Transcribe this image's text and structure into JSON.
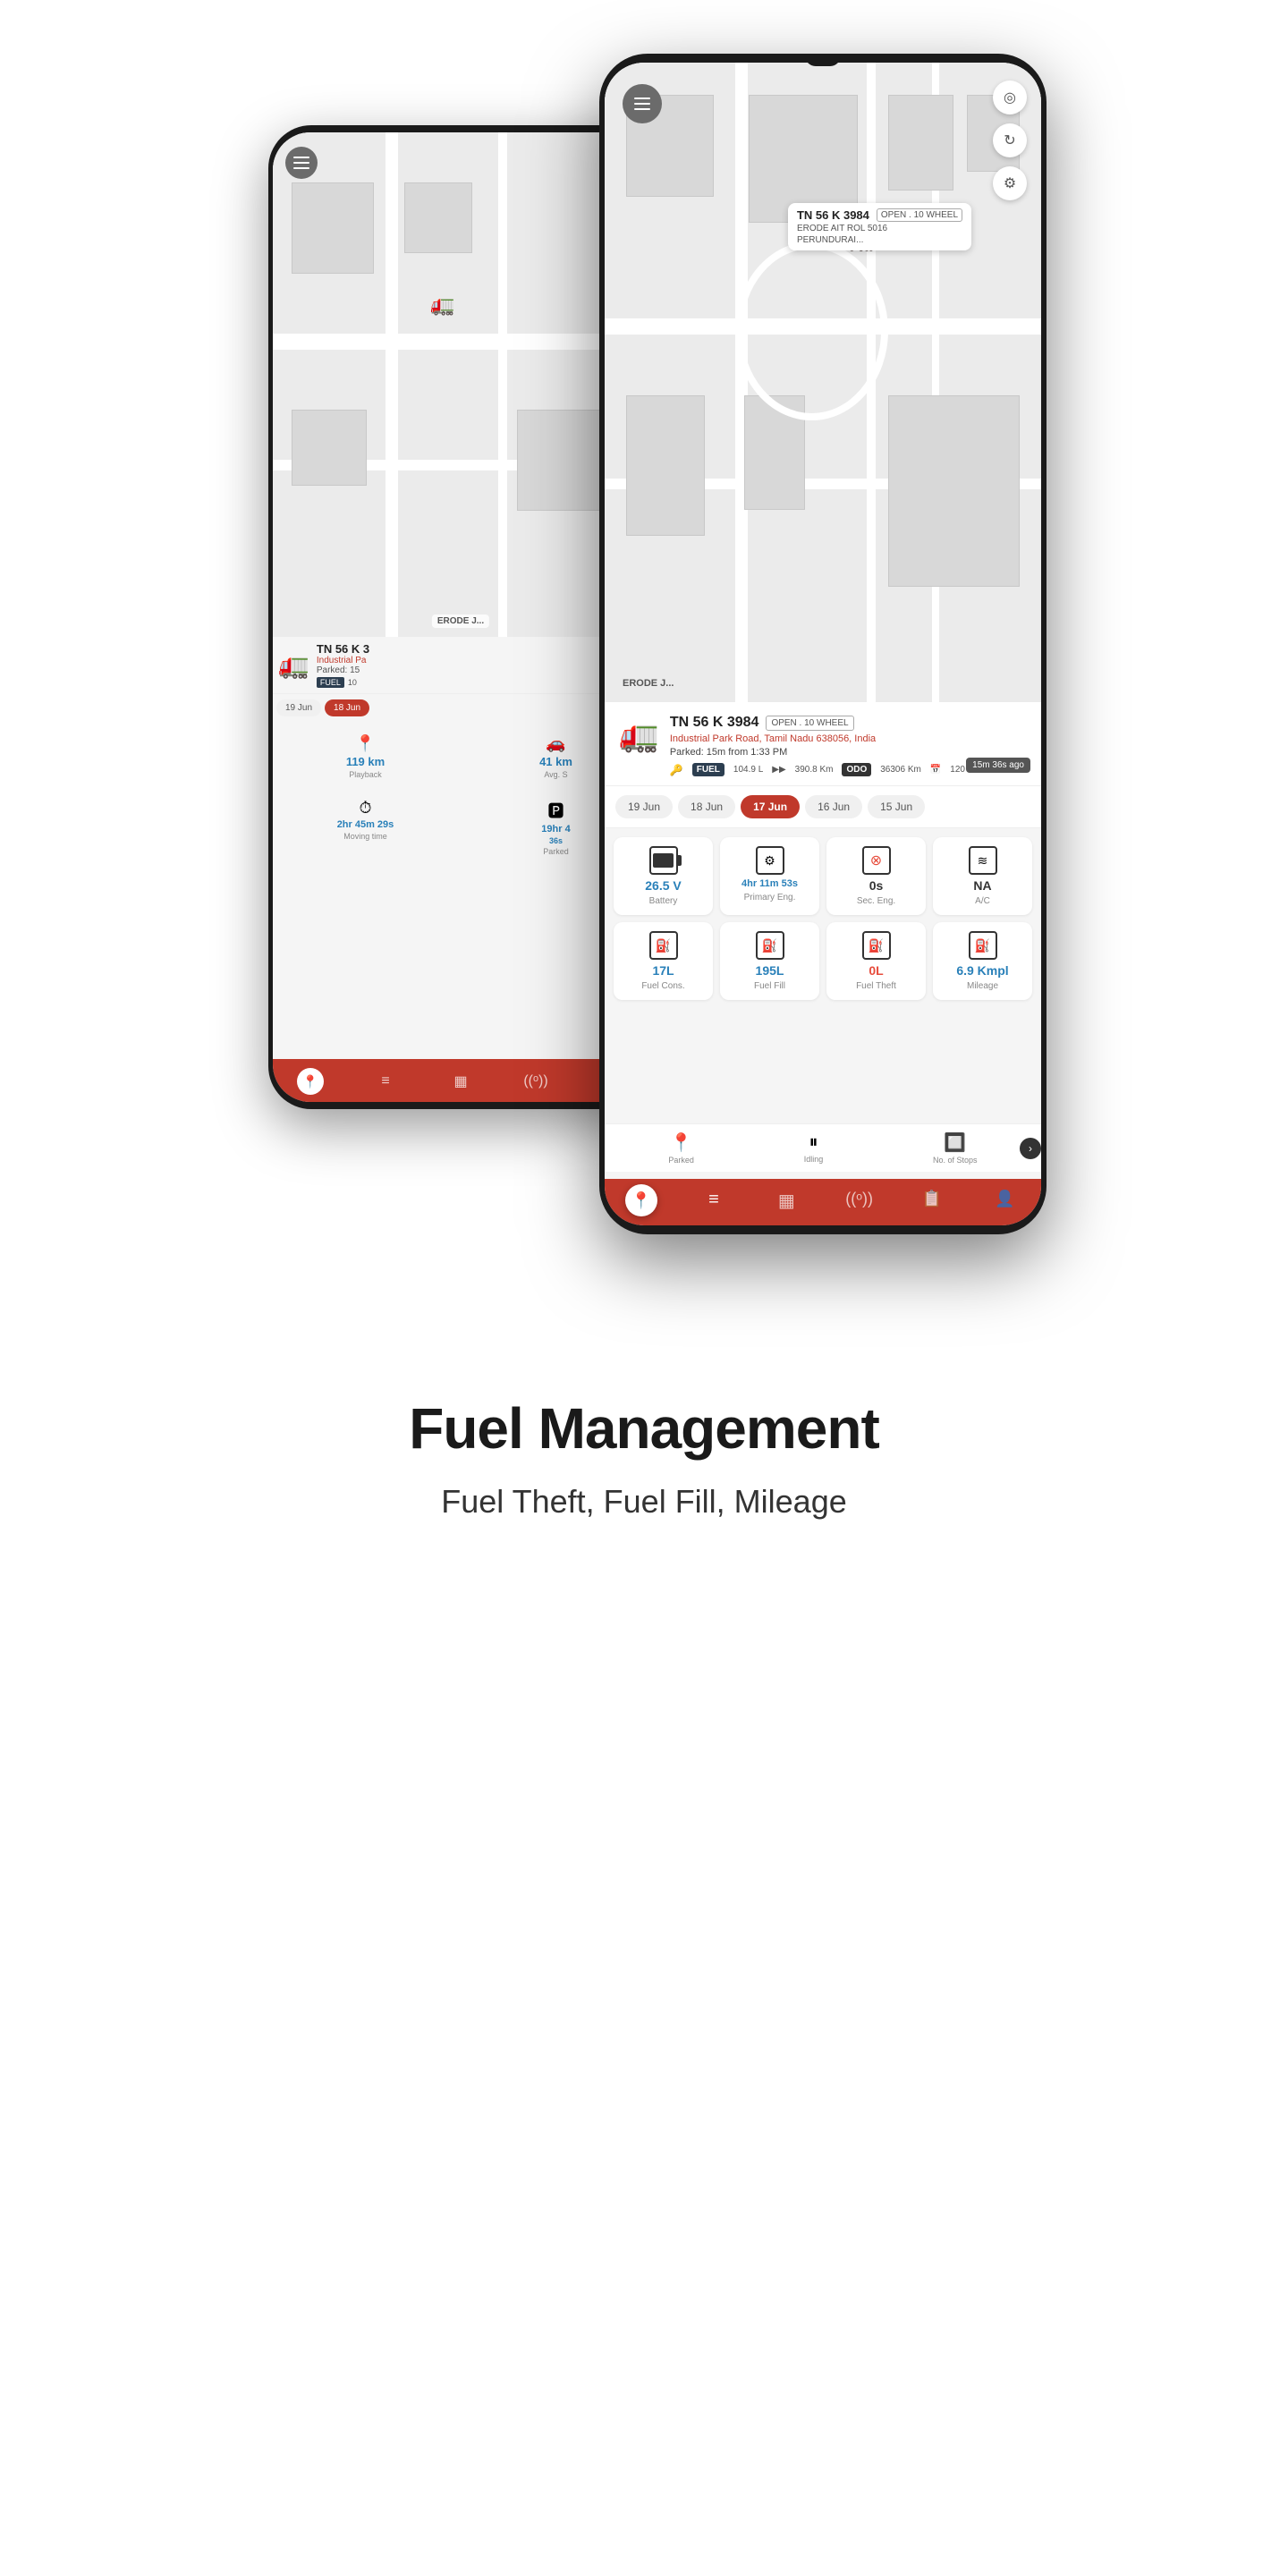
{
  "page": {
    "title": "Fuel Management",
    "subtitle": "Fuel Theft, Fuel Fill, Mileage"
  },
  "front_phone": {
    "vehicle": {
      "id": "TN 56 K 3984",
      "type": "OPEN . 10 WHEEL",
      "address": "Industrial Park Road, Tamil Nadu 638056, India",
      "status": "Parked: 15m from 1:33 PM",
      "fuel": "104.9 L",
      "distance": "390.8 Km",
      "odo": "36306 Km",
      "range": "120 Km",
      "time_ago": "15m 36s ago"
    },
    "map_tooltip": {
      "id": "TN 56 K 3984",
      "type": "OPEN . 10 WHEEL",
      "location": "PERUNDURAI..."
    },
    "date_tabs": [
      "19 Jun",
      "18 Jun",
      "17 Jun",
      "16 Jun",
      "15 Jun"
    ],
    "active_date": "17 Jun",
    "stats": [
      {
        "id": "battery",
        "icon": "🔋",
        "value": "26.5 V",
        "label": "Battery",
        "color": "blue"
      },
      {
        "id": "primary_eng",
        "icon": "⚙️",
        "value": "4hr 11m 53s",
        "label": "Primary Eng.",
        "color": "blue"
      },
      {
        "id": "sec_eng",
        "icon": "🔴",
        "value": "0s",
        "label": "Sec. Eng.",
        "color": "dark"
      },
      {
        "id": "ac",
        "icon": "❄️",
        "value": "NA",
        "label": "A/C",
        "color": "dark"
      },
      {
        "id": "fuel_cons",
        "icon": "⛽",
        "value": "17L",
        "label": "Fuel Cons.",
        "color": "blue"
      },
      {
        "id": "fuel_fill",
        "icon": "⛽",
        "value": "195L",
        "label": "Fuel Fill",
        "color": "blue"
      },
      {
        "id": "fuel_theft",
        "icon": "⛽",
        "value": "0L",
        "label": "Fuel Theft",
        "color": "red"
      },
      {
        "id": "mileage",
        "icon": "⛽",
        "value": "6.9 Kmpl",
        "label": "Mileage",
        "color": "blue"
      }
    ],
    "bottom_items": [
      "Parked",
      "Idling",
      "No. of Stops"
    ],
    "nav": [
      "location",
      "filter",
      "grid",
      "signal",
      "document",
      "profile"
    ]
  },
  "back_phone": {
    "vehicle": {
      "id": "TN 56 K 3",
      "address": "Industrial Pa",
      "status": "Parked: 15",
      "fuel": "10"
    },
    "date_tabs": [
      "19 Jun",
      "18 Jun"
    ],
    "stats": [
      {
        "id": "playback",
        "value": "119 km",
        "label": "Playback"
      },
      {
        "id": "avg_speed",
        "value": "41 km",
        "label": "Avg. S"
      },
      {
        "id": "moving_time",
        "value": "2hr 45m 29s",
        "label": "Moving time"
      },
      {
        "id": "parked",
        "value": "19hr 4 36s",
        "label": "Parked"
      }
    ]
  },
  "icons": {
    "menu": "☰",
    "location_pin": "📍",
    "target": "◎",
    "refresh": "↻",
    "settings": "⚙",
    "key": "🔑",
    "arrow_right": "›",
    "truck": "🚚",
    "fuel": "⛽",
    "battery": "🔋",
    "engine": "⚙",
    "snowflake": "❄",
    "chevron_right": "❯"
  }
}
